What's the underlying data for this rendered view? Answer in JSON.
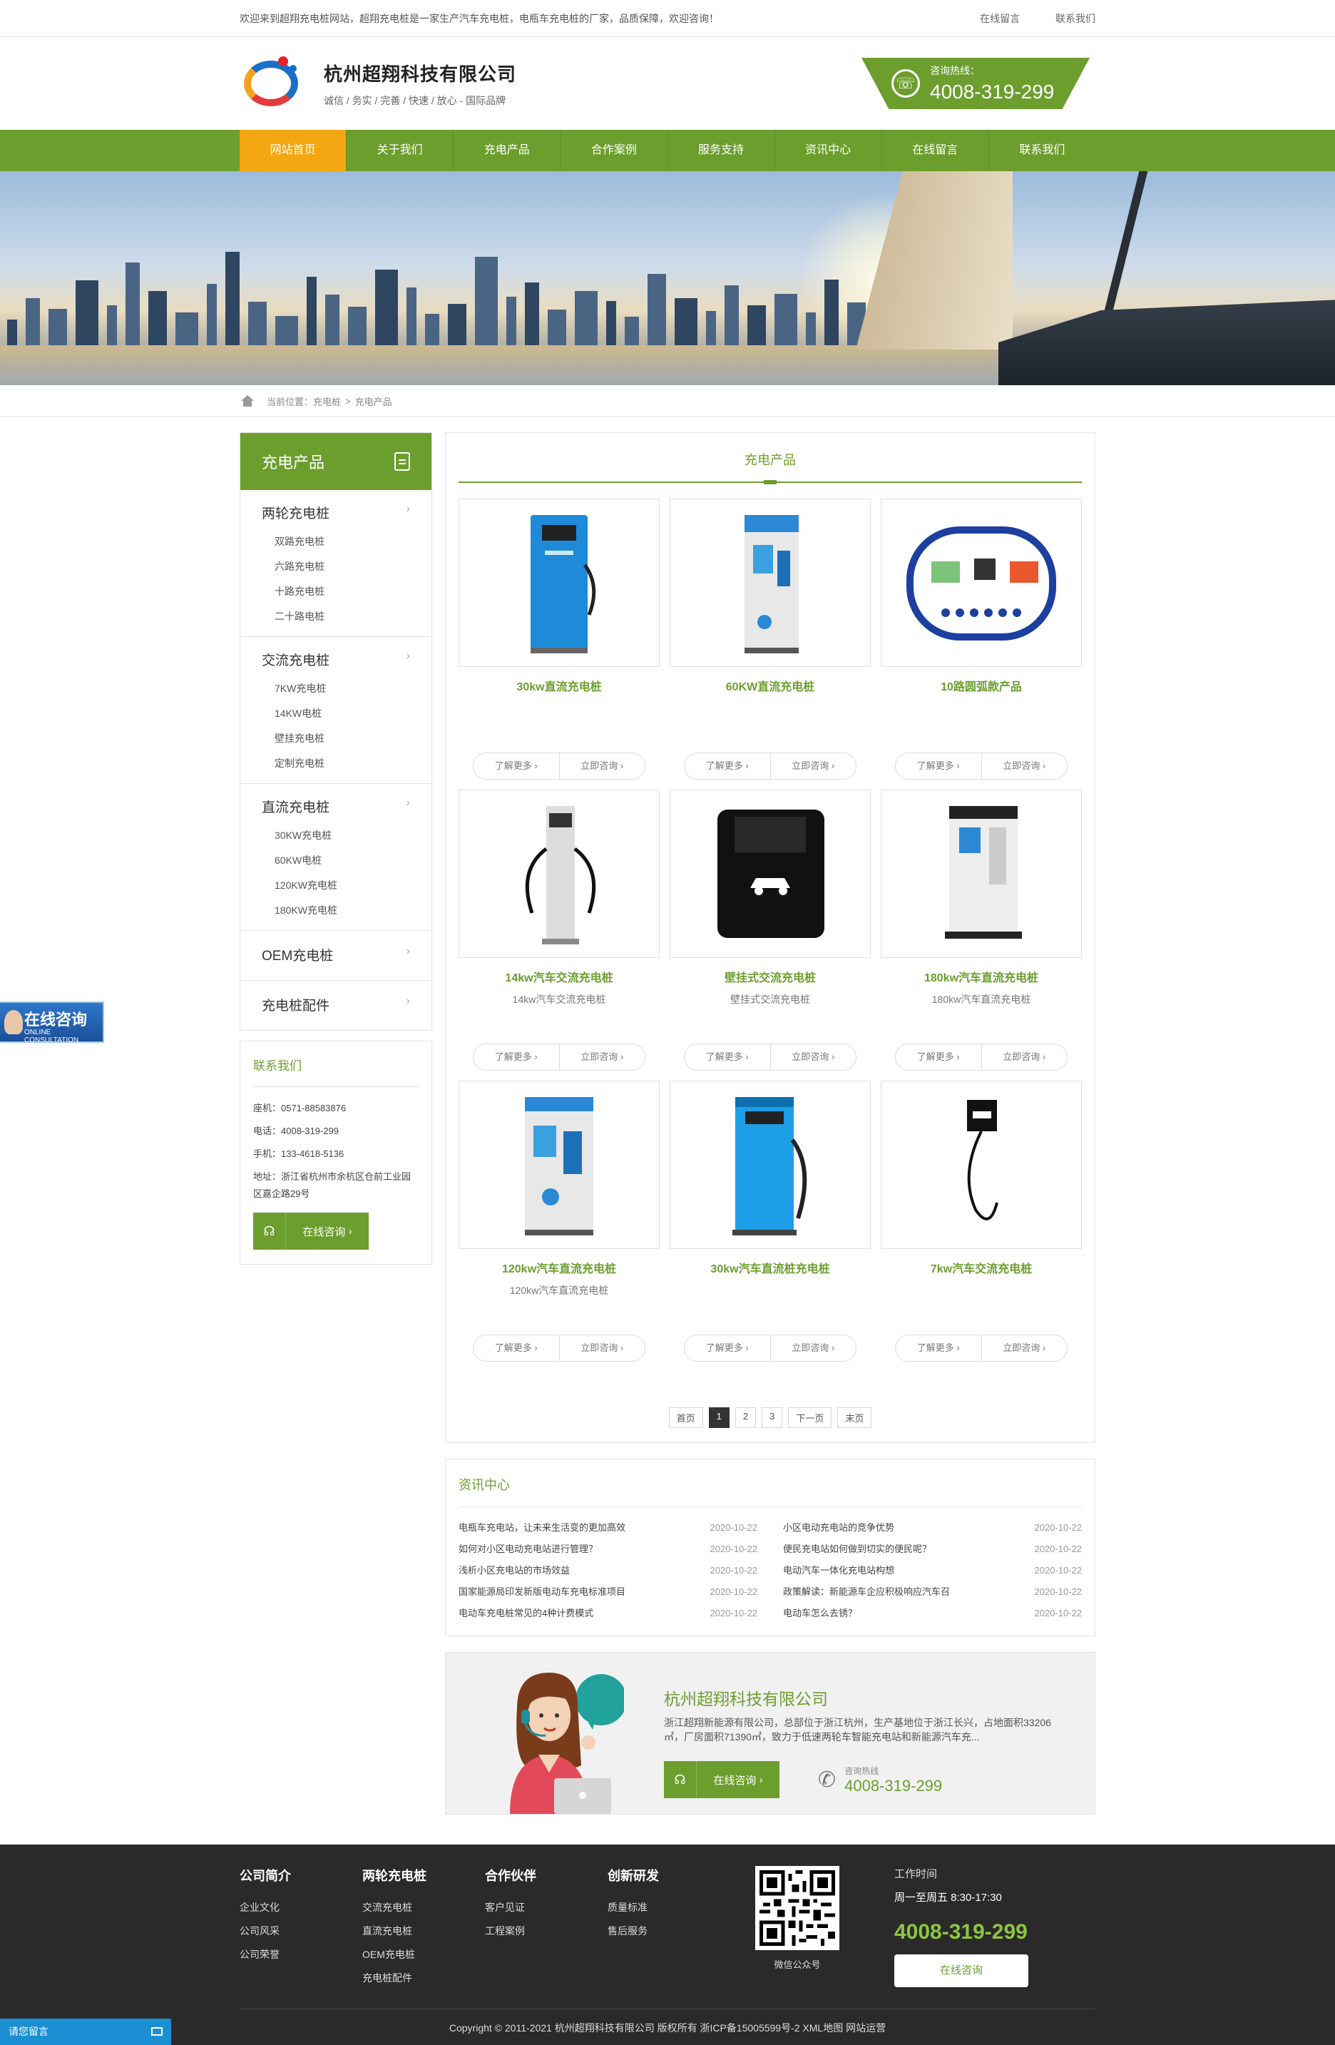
{
  "topbar": {
    "welcome": "欢迎来到超翔充电桩网站，超翔充电桩是一家生产汽车充电桩，电瓶车充电桩的厂家，品质保障，欢迎咨询！",
    "links": [
      "在线留言",
      "联系我们"
    ]
  },
  "header": {
    "company": "杭州超翔科技有限公司",
    "slogan": "诚信 / 务实 / 完善 / 快速 / 放心 - 国际品牌",
    "hotline_label": "咨询热线：",
    "hotline": "4008-319-299"
  },
  "nav": [
    "网站首页",
    "关于我们",
    "充电产品",
    "合作案例",
    "服务支持",
    "资讯中心",
    "在线留言",
    "联系我们"
  ],
  "breadcrumb": {
    "prefix": "当前位置：",
    "items": [
      "充电桩",
      "充电产品"
    ]
  },
  "sidebar": {
    "title": "充电产品",
    "categories": [
      {
        "name": "两轮充电桩",
        "subs": [
          "双路充电桩",
          "六路充电桩",
          "十路充电桩",
          "二十路电桩"
        ]
      },
      {
        "name": "交流充电桩",
        "subs": [
          "7KW充电桩",
          "14KW电桩",
          "壁挂充电桩",
          "定制充电桩"
        ]
      },
      {
        "name": "直流充电桩",
        "subs": [
          "30KW充电桩",
          "60KW电桩",
          "120KW充电桩",
          "180KW充电桩"
        ]
      },
      {
        "name": "OEM充电桩",
        "subs": []
      },
      {
        "name": "充电桩配件",
        "subs": []
      }
    ],
    "contact": {
      "title": "联系我们",
      "lines": [
        "座机：0571-88583876",
        "电话：4008-319-299",
        "手机：133-4618-5136"
      ],
      "address": "地址：浙江省杭州市余杭区仓前工业园区嘉企路29号",
      "button": "在线咨询"
    }
  },
  "products": {
    "title": "充电产品",
    "more_label": "了解更多 ›",
    "consult_label": "立即咨询 ›",
    "items": [
      {
        "name": "30kw直流充电桩",
        "desc": ""
      },
      {
        "name": "60KW直流充电桩",
        "desc": ""
      },
      {
        "name": "10路圆弧款产品",
        "desc": ""
      },
      {
        "name": "14kw汽车交流充电桩",
        "desc": "14kw汽车交流充电桩"
      },
      {
        "name": "壁挂式交流充电桩",
        "desc": "壁挂式交流充电桩"
      },
      {
        "name": "180kw汽车直流充电桩",
        "desc": "180kw汽车直流充电桩"
      },
      {
        "name": "120kw汽车直流充电桩",
        "desc": "120kw汽车直流充电桩"
      },
      {
        "name": "30kw汽车直流桩充电桩",
        "desc": ""
      },
      {
        "name": "7kw汽车交流充电桩",
        "desc": ""
      }
    ]
  },
  "pager": [
    "首页",
    "1",
    "2",
    "3",
    "下一页",
    "末页"
  ],
  "news": {
    "title": "资讯中心",
    "left": [
      {
        "t": "电瓶车充电站，让未来生活变的更加高效",
        "d": "2020-10-22"
      },
      {
        "t": "如何对小区电动充电站进行管理？",
        "d": "2020-10-22"
      },
      {
        "t": "浅析小区充电站的市场效益",
        "d": "2020-10-22"
      },
      {
        "t": "国家能源局印发新版电动车充电标准项目",
        "d": "2020-10-22"
      },
      {
        "t": "电动车充电桩常见的4种计费模式",
        "d": "2020-10-22"
      }
    ],
    "right": [
      {
        "t": "小区电动充电站的竞争优势",
        "d": "2020-10-22"
      },
      {
        "t": "便民充电站如何做到切实的便民呢？",
        "d": "2020-10-22"
      },
      {
        "t": "电动汽车一体化充电站构想",
        "d": "2020-10-22"
      },
      {
        "t": "政策解读：新能源车企应积极响应汽车召",
        "d": "2020-10-22"
      },
      {
        "t": "电动车怎么去锈？",
        "d": "2020-10-22"
      }
    ]
  },
  "about": {
    "company": "杭州超翔科技有限公司",
    "text": "浙江超翔新能源有限公司，总部位于浙江杭州，生产基地位于浙江长兴，占地面积33206㎡，厂房面积71390㎡，致力于低速两轮车智能充电站和新能源汽车充...",
    "button": "在线咨询",
    "hotline_label": "咨询热线",
    "hotline": "4008-319-299"
  },
  "footer": {
    "cols": [
      {
        "title": "公司简介",
        "items": [
          "企业文化",
          "公司风采",
          "公司荣誉"
        ]
      },
      {
        "title": "两轮充电桩",
        "items": [
          "交流充电桩",
          "直流充电桩",
          "OEM充电桩",
          "充电桩配件"
        ]
      },
      {
        "title": "合作伙伴",
        "items": [
          "客户见证",
          "工程案例"
        ]
      },
      {
        "title": "创新研发",
        "items": [
          "质量标准",
          "售后服务"
        ]
      }
    ],
    "qr_label": "微信公众号",
    "work_title": "工作时间",
    "work_hours": "周一至周五 8:30-17:30",
    "hotline": "4008-319-299",
    "button": "在线咨询",
    "copyright": "Copyright © 2011-2021 杭州超翔科技有限公司 版权所有 浙ICP备15005599号-2 XML地图 网站运营"
  },
  "float": {
    "online": "在线咨询",
    "online_en": "ONLINE CONSULTATION",
    "bottom": "请您留言"
  },
  "colors": {
    "brand_green": "#6c9e2e",
    "nav_active": "#f3a712",
    "footer_bg": "#2a2a2a"
  }
}
